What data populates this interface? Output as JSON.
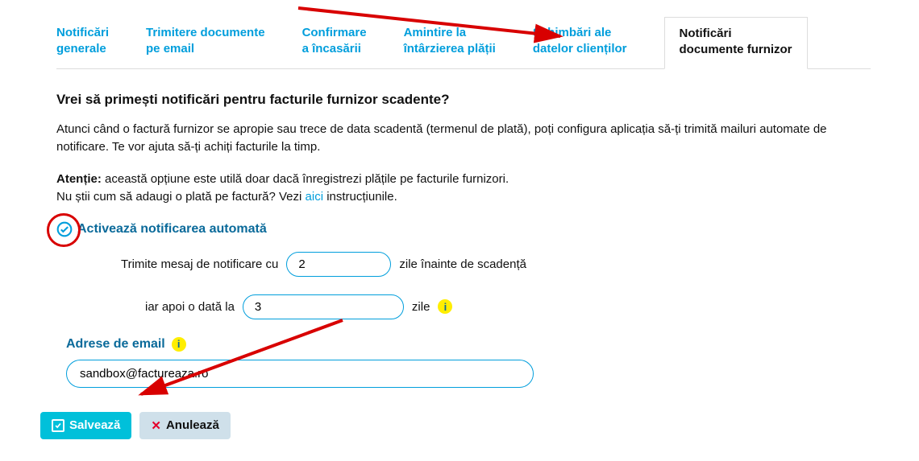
{
  "tabs": [
    {
      "label": "Notificări\ngenerale"
    },
    {
      "label": "Trimitere documente\npe email"
    },
    {
      "label": "Confirmare\na încasării"
    },
    {
      "label": "Amintire la\nîntârzierea plății"
    },
    {
      "label": "Schimbări ale\ndatelor clienților"
    },
    {
      "label": "Notificări\ndocumente furnizor"
    }
  ],
  "activeTab": 5,
  "heading": "Vrei să primești notificări pentru facturile furnizor scadente?",
  "paragraph": "Atunci când o factură furnizor se apropie sau trece de data scadentă (termenul de plată), poți configura aplicația să-ți trimită mailuri automate de notificare. Te vor ajuta să-ți achiți facturile la timp.",
  "warning": {
    "bold": "Atenție:",
    "line1": " această opțiune este utilă doar dacă înregistrezi plățile pe facturile furnizori.",
    "line2_pre": "Nu știi cum să adaugi o plată pe factură? Vezi ",
    "line2_link": "aici",
    "line2_post": " instrucțiunile."
  },
  "activate_label": "Activează notificarea automată",
  "cfg1": {
    "pre": "Trimite mesaj de notificare cu",
    "value": "2",
    "post": "zile înainte de scadență"
  },
  "cfg2": {
    "pre": "iar apoi o dată la",
    "value": "3",
    "post": "zile"
  },
  "email_section_label": "Adrese de email",
  "email_value": "sandbox@factureaza.ro",
  "buttons": {
    "save": "Salvează",
    "cancel": "Anulează"
  }
}
